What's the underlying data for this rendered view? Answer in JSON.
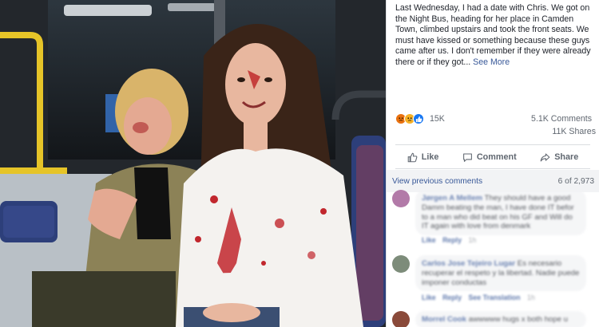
{
  "post": {
    "text": "Last Wednesday, I had a date with Chris. We got on the Night Bus, heading for her place in Camden Town, climbed upstairs and took the front seats. We must have kissed or something because these guys came after us. I don't remember if they were already there or if they got...",
    "see_more_label": "See More",
    "reactions_count": "15K",
    "comments_count": "5.1K Comments",
    "shares_count": "11K Shares",
    "reaction_icons": [
      "angry-emoji",
      "sad-emoji",
      "like-thumb"
    ]
  },
  "actions": {
    "like_label": "Like",
    "comment_label": "Comment",
    "share_label": "Share"
  },
  "comments_header": {
    "view_previous_label": "View previous comments",
    "count_label": "6 of 2,973"
  },
  "comments": [
    {
      "author": "Jørgen A Mellem",
      "text": "They should have a good Damm beating the man, I have done IT befor to a man who did beat on his GF and Will do IT again with love from denmark",
      "actions": [
        "Like",
        "Reply"
      ],
      "time": "1h"
    },
    {
      "author": "Carlos Jose Tejeiro Lugar",
      "text": "Es necesario recuperar el respeto y la libertad. Nadie puede imponer conductas",
      "actions": [
        "Like",
        "Reply",
        "See Translation"
      ],
      "time": "1h"
    },
    {
      "author": "Morrel Cook",
      "text": "awwwww hugs x both hope u",
      "actions": [],
      "time": ""
    }
  ],
  "colors": {
    "link": "#385898",
    "muted": "#606770",
    "bubble": "#f2f3f5",
    "accent_blue": "#1877f2"
  }
}
